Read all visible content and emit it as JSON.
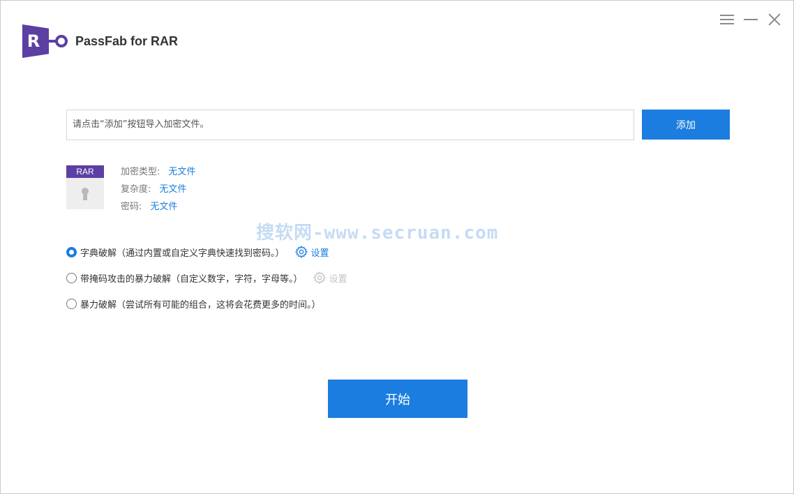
{
  "app": {
    "title": "PassFab for RAR",
    "logo_letter": "R"
  },
  "file": {
    "placeholder": "请点击“添加”按钮导入加密文件。",
    "add_label": "添加"
  },
  "thumb": {
    "tag": "RAR"
  },
  "info": [
    {
      "key": "加密类型:",
      "value": "无文件"
    },
    {
      "key": "复杂度:",
      "value": "无文件"
    },
    {
      "key": "密码:",
      "value": "无文件"
    }
  ],
  "watermark": "搜软网-www.secruan.com",
  "options": [
    {
      "label": "字典破解（通过内置或自定义字典快速找到密码。）",
      "settings": "设置",
      "checked": true,
      "settings_enabled": true
    },
    {
      "label": "带掩码攻击的暴力破解（自定义数字，字符，字母等。）",
      "settings": "设置",
      "checked": false,
      "settings_enabled": false
    },
    {
      "label": "暴力破解（尝试所有可能的组合，这将会花费更多的时间。）",
      "checked": false
    }
  ],
  "start_label": "开始",
  "colors": {
    "accent": "#1b7ddf",
    "brand": "#5b3fa3"
  }
}
